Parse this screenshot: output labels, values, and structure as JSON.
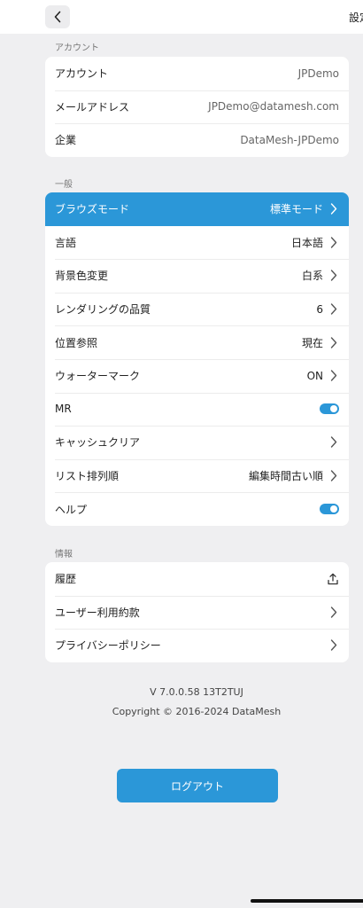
{
  "header": {
    "title": "設定"
  },
  "account_section": {
    "label": "アカウント",
    "rows": [
      {
        "label": "アカウント",
        "value": "JPDemo"
      },
      {
        "label": "メールアドレス",
        "value": "JPDemo@datamesh.com"
      },
      {
        "label": "企業",
        "value": "DataMesh-JPDemo"
      }
    ]
  },
  "general_section": {
    "label": "一般",
    "rows": [
      {
        "label": "ブラウズモード",
        "value": "標準モード"
      },
      {
        "label": "言語",
        "value": "日本語"
      },
      {
        "label": "背景色変更",
        "value": "白系"
      },
      {
        "label": "レンダリングの品質",
        "value": "6"
      },
      {
        "label": "位置参照",
        "value": "現在"
      },
      {
        "label": "ウォーターマーク",
        "value": "ON"
      },
      {
        "label": "MR",
        "toggle_on": true
      },
      {
        "label": "キャッシュクリア"
      },
      {
        "label": "リスト排列順",
        "value": "編集時間古い順"
      },
      {
        "label": "ヘルプ",
        "toggle_on": true
      }
    ]
  },
  "info_section": {
    "label": "情報",
    "rows": [
      {
        "label": "履歴",
        "icon": "share-upload-icon"
      },
      {
        "label": "ユーザー利用約款"
      },
      {
        "label": "プライバシーポリシー"
      }
    ]
  },
  "footer": {
    "version": "V 7.0.0.58 13T2TUJ",
    "copyright": "Copyright © 2016-2024 DataMesh",
    "logout_label": "ログアウト"
  },
  "colors": {
    "accent": "#2b97d8",
    "background": "#efeff1",
    "card": "#ffffff"
  }
}
